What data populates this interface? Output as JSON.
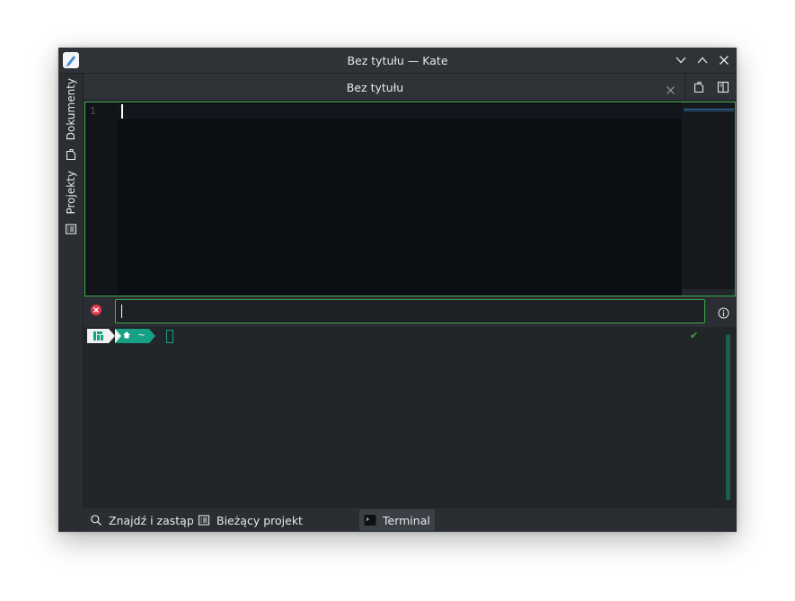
{
  "window": {
    "title": "Bez tytułu — Kate",
    "app_icon": "kate-pen-icon",
    "controls": [
      "minimize-icon",
      "maximize-icon",
      "close-icon"
    ]
  },
  "left_sidebar": {
    "items": [
      {
        "label": "Dokumenty",
        "icon": "document-icon"
      },
      {
        "label": "Projekty",
        "icon": "project-list-icon"
      }
    ]
  },
  "document_tab": {
    "label": "Bez tytułu",
    "close_icon": "close-icon",
    "actions": [
      "new-document-icon",
      "split-view-icon"
    ]
  },
  "editor": {
    "line_numbers": [
      "1"
    ],
    "content": ""
  },
  "command_bar": {
    "value": "",
    "close_icon": "error-close-icon",
    "info_icon": "info-icon"
  },
  "terminal": {
    "os_icon": "manjaro-logo-icon",
    "home_icon": "home-icon",
    "dir": "~",
    "status": "✔"
  },
  "bottom_tabs": [
    {
      "label": "Znajdź i zastąp",
      "icon": "search-icon",
      "active": false
    },
    {
      "label": "Bieżący projekt",
      "icon": "project-list-icon",
      "active": false
    },
    {
      "label": "Terminal",
      "icon": "terminal-icon",
      "active": true
    }
  ],
  "colors": {
    "accent_green": "#3daa4a",
    "terminal_teal": "#16a085",
    "window_bg": "#2a2e32",
    "editor_bg": "#0b0e13"
  }
}
